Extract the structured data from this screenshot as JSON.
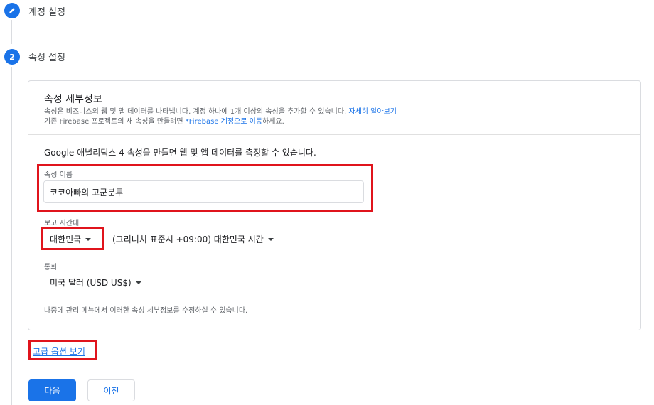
{
  "steps": [
    {
      "number": "",
      "title": "계정 설정",
      "icon": "pencil-icon",
      "state": "completed"
    },
    {
      "number": "2",
      "title": "속성 설정",
      "state": "active"
    }
  ],
  "property_details": {
    "title": "속성 세부정보",
    "desc_line1": "속성은 비즈니스의 웹 및 앱 데이터를 나타냅니다. 계정 하나에 1개 이상의 속성을 추가할 수 있습니다. ",
    "learn_more": "자세히 알아보기",
    "desc_line2_prefix": "기존 Firebase 프로젝트의 새 속성을 만들려면 ",
    "firebase_link": "*Firebase 계정으로 이동",
    "desc_line2_suffix": "하세요."
  },
  "form": {
    "intro": "Google 애널리틱스 4 속성을 만들면 웹 및 앱 데이터를 측정할 수 있습니다.",
    "property_name_label": "속성 이름",
    "property_name_value": "코코아빠의 고군분투",
    "timezone_label": "보고 시간대",
    "country_value": "대한민국",
    "timezone_value": "(그리니치 표준시 +09:00) 대한민국 시간",
    "currency_label": "통화",
    "currency_value": "미국 달러 (USD US$)",
    "note": "나중에 관리 메뉴에서 이러한 속성 세부정보를 수정하실 수 있습니다."
  },
  "advanced_link": "고급 옵션 보기",
  "buttons": {
    "next": "다음",
    "previous": "이전"
  },
  "colors": {
    "accent": "#1a73e8",
    "highlight": "#e0141c"
  }
}
